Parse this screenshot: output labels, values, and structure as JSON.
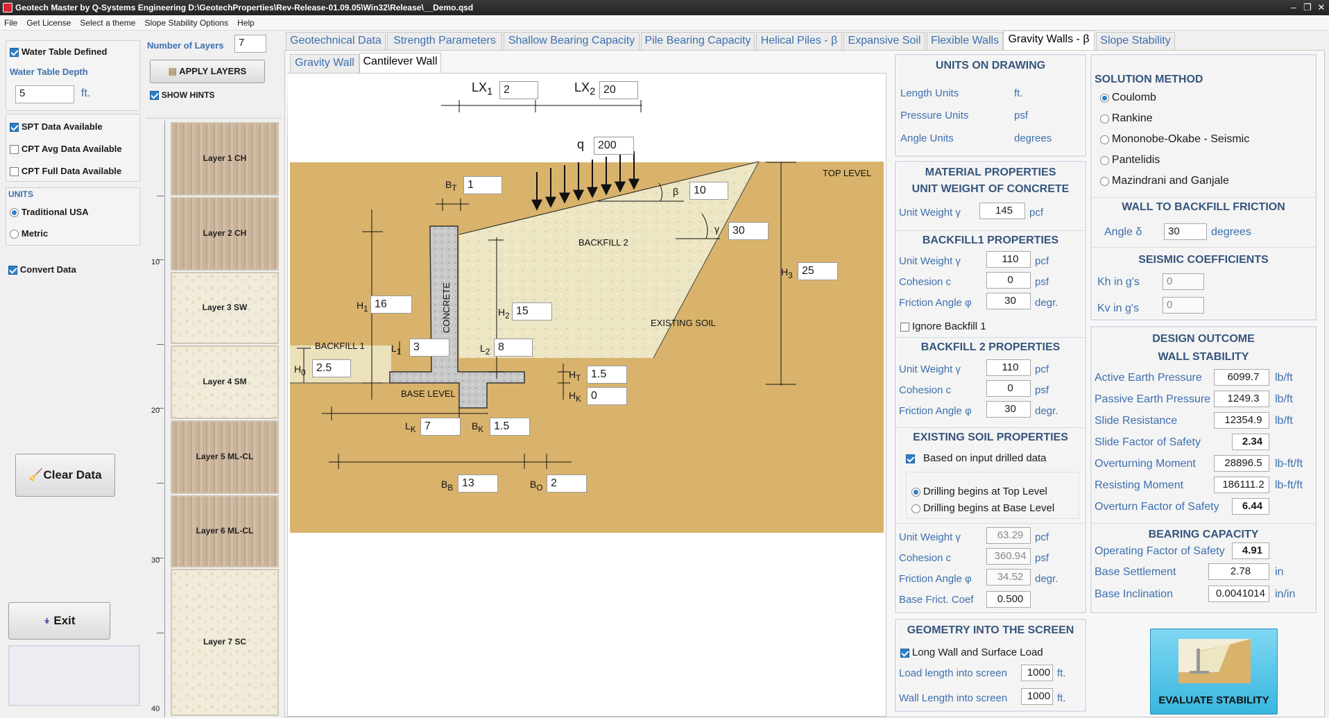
{
  "window": {
    "title": "Geotech Master by Q-Systems Engineering   D:\\GeotechProperties\\Rev-Release-01.09.05\\Win32\\Release\\__Demo.qsd"
  },
  "menu": [
    "File",
    "Get License",
    "Select a theme",
    "Slope Stability Options",
    "Help"
  ],
  "left": {
    "water_table_defined": "Water Table Defined",
    "water_table_depth_label": "Water Table Depth",
    "water_table_depth": "5",
    "depth_unit": "ft.",
    "spt": "SPT Data Available",
    "cpt_avg": "CPT Avg Data Available",
    "cpt_full": "CPT Full Data Available",
    "units_title": "UNITS",
    "units_usa": "Traditional USA",
    "units_metric": "Metric",
    "convert": "Convert Data",
    "clear": "Clear Data",
    "exit": "Exit"
  },
  "layers_panel": {
    "num_label": "Number of Layers",
    "num": "7",
    "apply": "APPLY LAYERS",
    "hints": "SHOW HINTS",
    "ticks": [
      "10",
      "20",
      "30",
      "40"
    ],
    "layers": [
      "Layer 1 CH",
      "Layer 2 CH",
      "Layer 3 SW",
      "Layer 4 SM",
      "Layer 5 ML-CL",
      "Layer 6 ML-CL",
      "Layer 7 SC"
    ]
  },
  "tabs": [
    "Geotechnical Data",
    "Strength Parameters",
    "Shallow Bearing Capacity",
    "Pile Bearing Capacity",
    "Helical Piles - β",
    "Expansive Soil",
    "Flexible Walls",
    "Gravity Walls - β",
    "Slope Stability"
  ],
  "subtabs": [
    "Gravity Wall",
    "Cantilever Wall"
  ],
  "drawing": {
    "lx1_label": "LX",
    "lx1_sub": "1",
    "lx1": "2",
    "lx2_label": "LX",
    "lx2_sub": "2",
    "lx2": "20",
    "q_label": "q",
    "q": "200",
    "bt_label": "B",
    "bt_sub": "T",
    "bt": "1",
    "beta_label": "β",
    "beta": "10",
    "gamma_label": "γ",
    "gamma": "30",
    "top_level": "TOP LEVEL",
    "backfill2": "BACKFILL 2",
    "h3_label": "H",
    "h3_sub": "3",
    "h3": "25",
    "h1_label": "H",
    "h1_sub": "1",
    "h1": "16",
    "h2_label": "H",
    "h2_sub": "2",
    "h2": "15",
    "concrete": "CONCRETE",
    "existing": "EXISTING SOIL",
    "backfill1": "BACKFILL 1",
    "l1_label": "L",
    "l1_sub": "1",
    "l1": "3",
    "l2_label": "L",
    "l2_sub": "2",
    "l2": "8",
    "h0_label": "H",
    "h0_sub": "0",
    "h0": "2.5",
    "ht_label": "H",
    "ht_sub": "T",
    "ht": "1.5",
    "hk_label": "H",
    "hk_sub": "K",
    "hk": "0",
    "base_level": "BASE LEVEL",
    "lk_label": "L",
    "lk_sub": "K",
    "lk": "7",
    "bk_label": "B",
    "bk_sub": "K",
    "bk": "1.5",
    "bb_label": "B",
    "bb_sub": "B",
    "bb": "13",
    "bo_label": "B",
    "bo_sub": "O",
    "bo": "2"
  },
  "units": {
    "title": "UNITS ON DRAWING",
    "rows": [
      [
        "Length Units",
        "ft."
      ],
      [
        "Pressure Units",
        "psf"
      ],
      [
        "Angle Units",
        "degrees"
      ]
    ]
  },
  "material": {
    "title": "MATERIAL PROPERTIES",
    "concrete_title": "UNIT WEIGHT OF CONCRETE",
    "concrete": {
      "label": "Unit Weight γ",
      "value": "145",
      "unit": "pcf"
    },
    "bf1_title": "BACKFILL1 PROPERTIES",
    "bf1": [
      [
        "Unit Weight γ",
        "110",
        "pcf"
      ],
      [
        "Cohesion  c",
        "0",
        "psf"
      ],
      [
        "Friction Angle φ",
        "30",
        "degr."
      ]
    ],
    "ignore_bf1": "Ignore Backfill 1",
    "bf2_title": "BACKFILL 2 PROPERTIES",
    "bf2": [
      [
        "Unit Weight γ",
        "110",
        "pcf"
      ],
      [
        "Cohesion  c",
        "0",
        "psf"
      ],
      [
        "Friction Angle φ",
        "30",
        "degr."
      ]
    ],
    "ex_title": "EXISTING SOIL PROPERTIES",
    "ex_based": "Based on input drilled data",
    "ex_top": "Drilling begins at Top Level",
    "ex_base": "Drilling begins at Base Level",
    "ex": [
      [
        "Unit Weight γ",
        "63.29",
        "pcf"
      ],
      [
        "Cohesion  c",
        "360.94",
        "psf"
      ],
      [
        "Friction Angle φ",
        "34.52",
        "degr."
      ]
    ],
    "base_frict_label": "Base Frict. Coef",
    "base_frict": "0.500"
  },
  "geometry": {
    "title": "GEOMETRY INTO THE SCREEN",
    "long_wall": "Long Wall and Surface Load",
    "load_label": "Load length into screen",
    "load": "1000",
    "load_unit": "ft.",
    "wall_label": "Wall Length into screen",
    "wall": "1000",
    "wall_unit": "ft."
  },
  "solution": {
    "title": "SOLUTION METHOD",
    "methods": [
      "Coulomb",
      "Rankine",
      "Mononobe-Okabe - Seismic",
      "Pantelidis",
      "Mazindrani and Ganjale"
    ],
    "friction_title": "WALL TO BACKFILL FRICTION",
    "angle_label": "Angle δ",
    "angle": "30",
    "angle_unit": "degrees",
    "seismic_title": "SEISMIC COEFFICIENTS",
    "kh_label": "Kh in g's",
    "kh": "0",
    "kv_label": "Kv in g's",
    "kv": "0"
  },
  "outcome": {
    "title": "DESIGN OUTCOME",
    "stab_title": "WALL STABILITY",
    "rows": [
      [
        "Active Earth Pressure",
        "6099.7",
        "lb/ft"
      ],
      [
        "Passive Earth Pressure",
        "1249.3",
        "lb/ft"
      ],
      [
        "Slide Resistance",
        "12354.9",
        "lb/ft"
      ],
      [
        "Slide Factor of Safety",
        "2.34",
        ""
      ],
      [
        "Overturning Moment",
        "28896.5",
        "lb-ft/ft"
      ],
      [
        "Resisting Moment",
        "186111.2",
        "lb-ft/ft"
      ],
      [
        "Overturn Factor of Safety",
        "6.44",
        ""
      ]
    ],
    "bearing_title": "BEARING CAPACITY",
    "bearing": [
      [
        "Operating Factor of Safety",
        "4.91",
        ""
      ],
      [
        "Base Settlement",
        "2.78",
        "in"
      ],
      [
        "Base Inclination",
        "0.0041014",
        "in/in"
      ]
    ]
  },
  "evaluate": "EVALUATE STABILITY"
}
